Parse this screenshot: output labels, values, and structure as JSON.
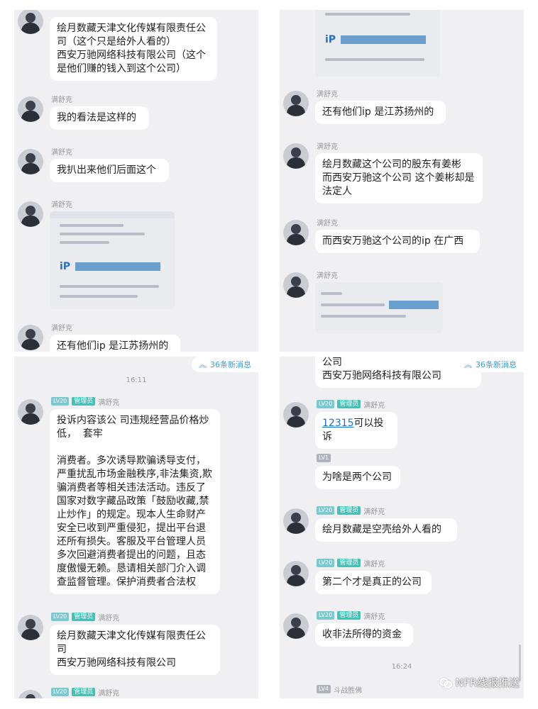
{
  "sender": "满舒克",
  "badges": {
    "lv20": "LV20",
    "admin": "管理员",
    "lv1": "LV1",
    "lv4": "LV4"
  },
  "panel1": {
    "msg1": "绘月数藏天津文化传媒有限责任公司（这个只是给外人看的）\n西安万驰网络科技有限公司（这个是他们赚的钱入到这个公司）",
    "msg2": "我的看法是这样的",
    "msg3": "我扒出来他们后面这个",
    "msg5": "还有他们ip 是江苏扬州的"
  },
  "panel2": {
    "msg1": "还有他们ip 是江苏扬州的",
    "msg2": "绘月数藏这个公司的股东有姜彬\n而西安万驰这个公司 这个姜彬却是法定人",
    "msg3": "而西安万驰这个公司的ip 在广西"
  },
  "panel3": {
    "new_messages": "36条新消息",
    "time": "16:11",
    "msg1": "投诉内容该公 司违规经营品价格炒低，  套牢\n\n消费者。多次诱导欺骗诱导支付，严重扰乱市场金融秩序,非法集资,欺骗消费者等相关违法活动。违反了国家对数字藏品政策「鼓励收藏,禁止炒作」的规定。现本人生命财产安全已收到严重侵犯，提出平台退还所有损失。客服及平台管理人员多次回避消费者提出的问题，且态度傲慢无赖。恳请相关部门介入调查监督管理。保护消费者合法权",
    "msg2": "绘月数藏天津文化传媒有限责任公司\n西安万驰网络科技有限公司"
  },
  "panel4": {
    "new_messages": "36条新消息",
    "top_fragment": "公司\n西安万驰网络科技有限公司",
    "msg1_link": "12315",
    "msg1_rest": "可以投诉",
    "msg2": "为啥是两个公司",
    "msg3": "绘月数藏是空壳给外人看的",
    "msg4": "第二个才是真正的公司",
    "msg5": "收非法所得的资金",
    "time": "16:24",
    "last_sender": "斗战胜佛"
  },
  "watermark": "NFR线报推送",
  "colors": {
    "panel_bg": "#f0f0f2",
    "bubble": "#ffffff",
    "admin_badge": "#40c4b8",
    "link": "#1a73c8"
  }
}
